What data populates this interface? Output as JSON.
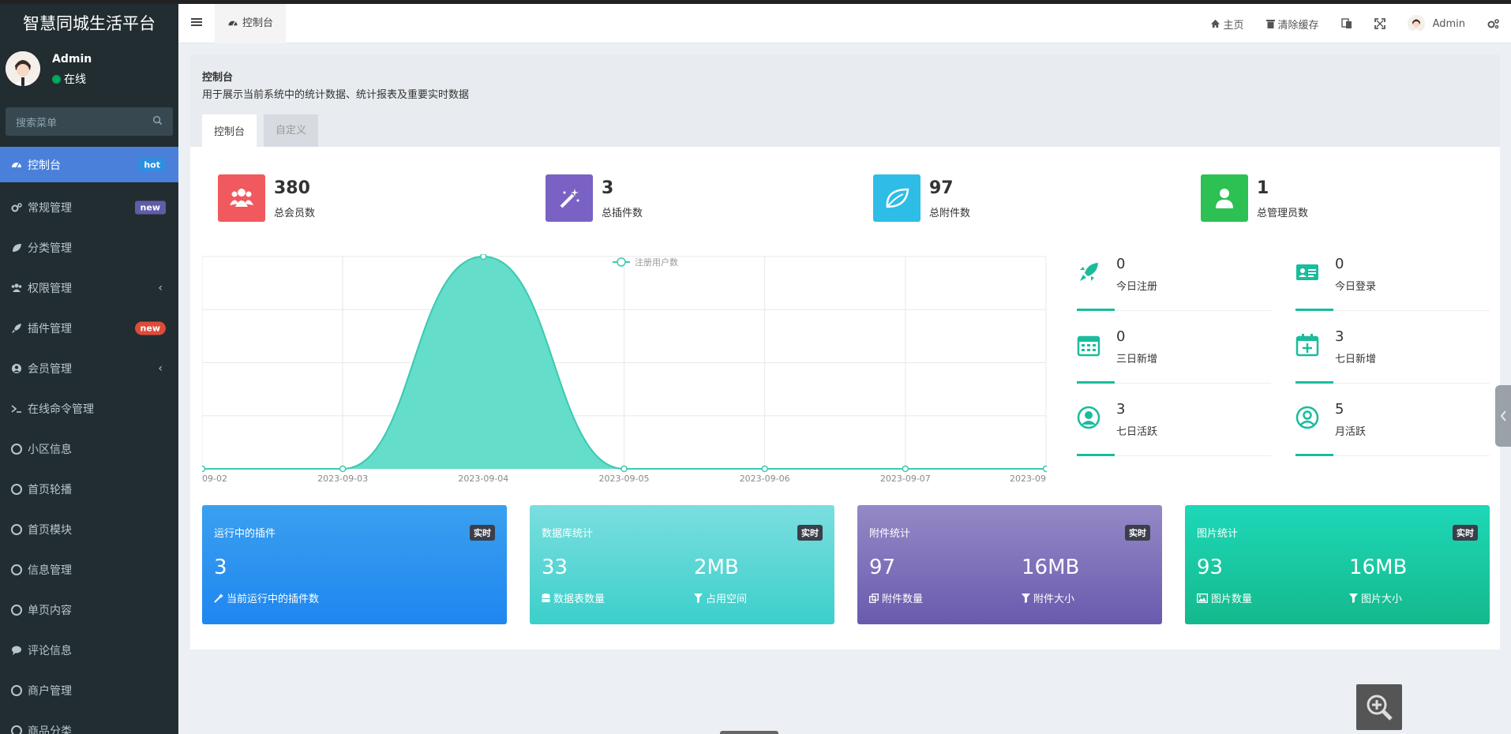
{
  "app": {
    "brand": "智慧同城生活平台"
  },
  "user": {
    "name": "Admin",
    "status": "在线"
  },
  "search": {
    "placeholder": "搜索菜单"
  },
  "sidebar": {
    "items": [
      {
        "label": "控制台",
        "badge": "hot"
      },
      {
        "label": "常规管理",
        "badge": "new"
      },
      {
        "label": "分类管理"
      },
      {
        "label": "权限管理",
        "caret": "‹"
      },
      {
        "label": "插件管理",
        "badge": "new"
      },
      {
        "label": "会员管理",
        "caret": "‹"
      },
      {
        "label": "在线命令管理"
      },
      {
        "label": "小区信息"
      },
      {
        "label": "首页轮播"
      },
      {
        "label": "首页模块"
      },
      {
        "label": "信息管理"
      },
      {
        "label": "单页内容"
      },
      {
        "label": "评论信息"
      },
      {
        "label": "商户管理"
      },
      {
        "label": "商品分类"
      }
    ]
  },
  "header": {
    "tab": "控制台",
    "home": "主页",
    "clear_cache": "清除缓存",
    "admin": "Admin"
  },
  "content": {
    "title": "控制台",
    "desc": "用于展示当前系统中的统计数据、统计报表及重要实时数据",
    "tabs": [
      "控制台",
      "自定义"
    ]
  },
  "stats": [
    {
      "value": "380",
      "label": "总会员数",
      "color": "#f0595d"
    },
    {
      "value": "3",
      "label": "总插件数",
      "color": "#7a62c4"
    },
    {
      "value": "97",
      "label": "总附件数",
      "color": "#2dbde7"
    },
    {
      "value": "1",
      "label": "总管理员数",
      "color": "#2cc152"
    }
  ],
  "chart_data": {
    "type": "area",
    "legend": "注册用户数",
    "categories": [
      "09-02",
      "2023-09-03",
      "2023-09-04",
      "2023-09-05",
      "2023-09-06",
      "2023-09-07",
      "2023-09"
    ],
    "values": [
      0,
      0,
      1,
      0,
      0,
      0,
      0
    ],
    "color": "#5cdbc8"
  },
  "mini_stats": [
    {
      "value": "0",
      "label": "今日注册"
    },
    {
      "value": "0",
      "label": "今日登录"
    },
    {
      "value": "0",
      "label": "三日新增"
    },
    {
      "value": "3",
      "label": "七日新增"
    },
    {
      "value": "3",
      "label": "七日活跃"
    },
    {
      "value": "5",
      "label": "月活跃"
    }
  ],
  "panels": [
    {
      "title": "运行中的插件",
      "tag": "实时",
      "v1": "3",
      "l1": "当前运行中的插件数"
    },
    {
      "title": "数据库统计",
      "tag": "实时",
      "v1": "33",
      "l1": "数据表数量",
      "v2": "2MB",
      "l2": "占用空间"
    },
    {
      "title": "附件统计",
      "tag": "实时",
      "v1": "97",
      "l1": "附件数量",
      "v2": "16MB",
      "l2": "附件大小"
    },
    {
      "title": "图片统计",
      "tag": "实时",
      "v1": "93",
      "l1": "图片数量",
      "v2": "16MB",
      "l2": "图片大小"
    }
  ],
  "colors": {
    "accent": "#1abc9c",
    "sidebar": "#222d32",
    "active": "#4a80d9"
  }
}
